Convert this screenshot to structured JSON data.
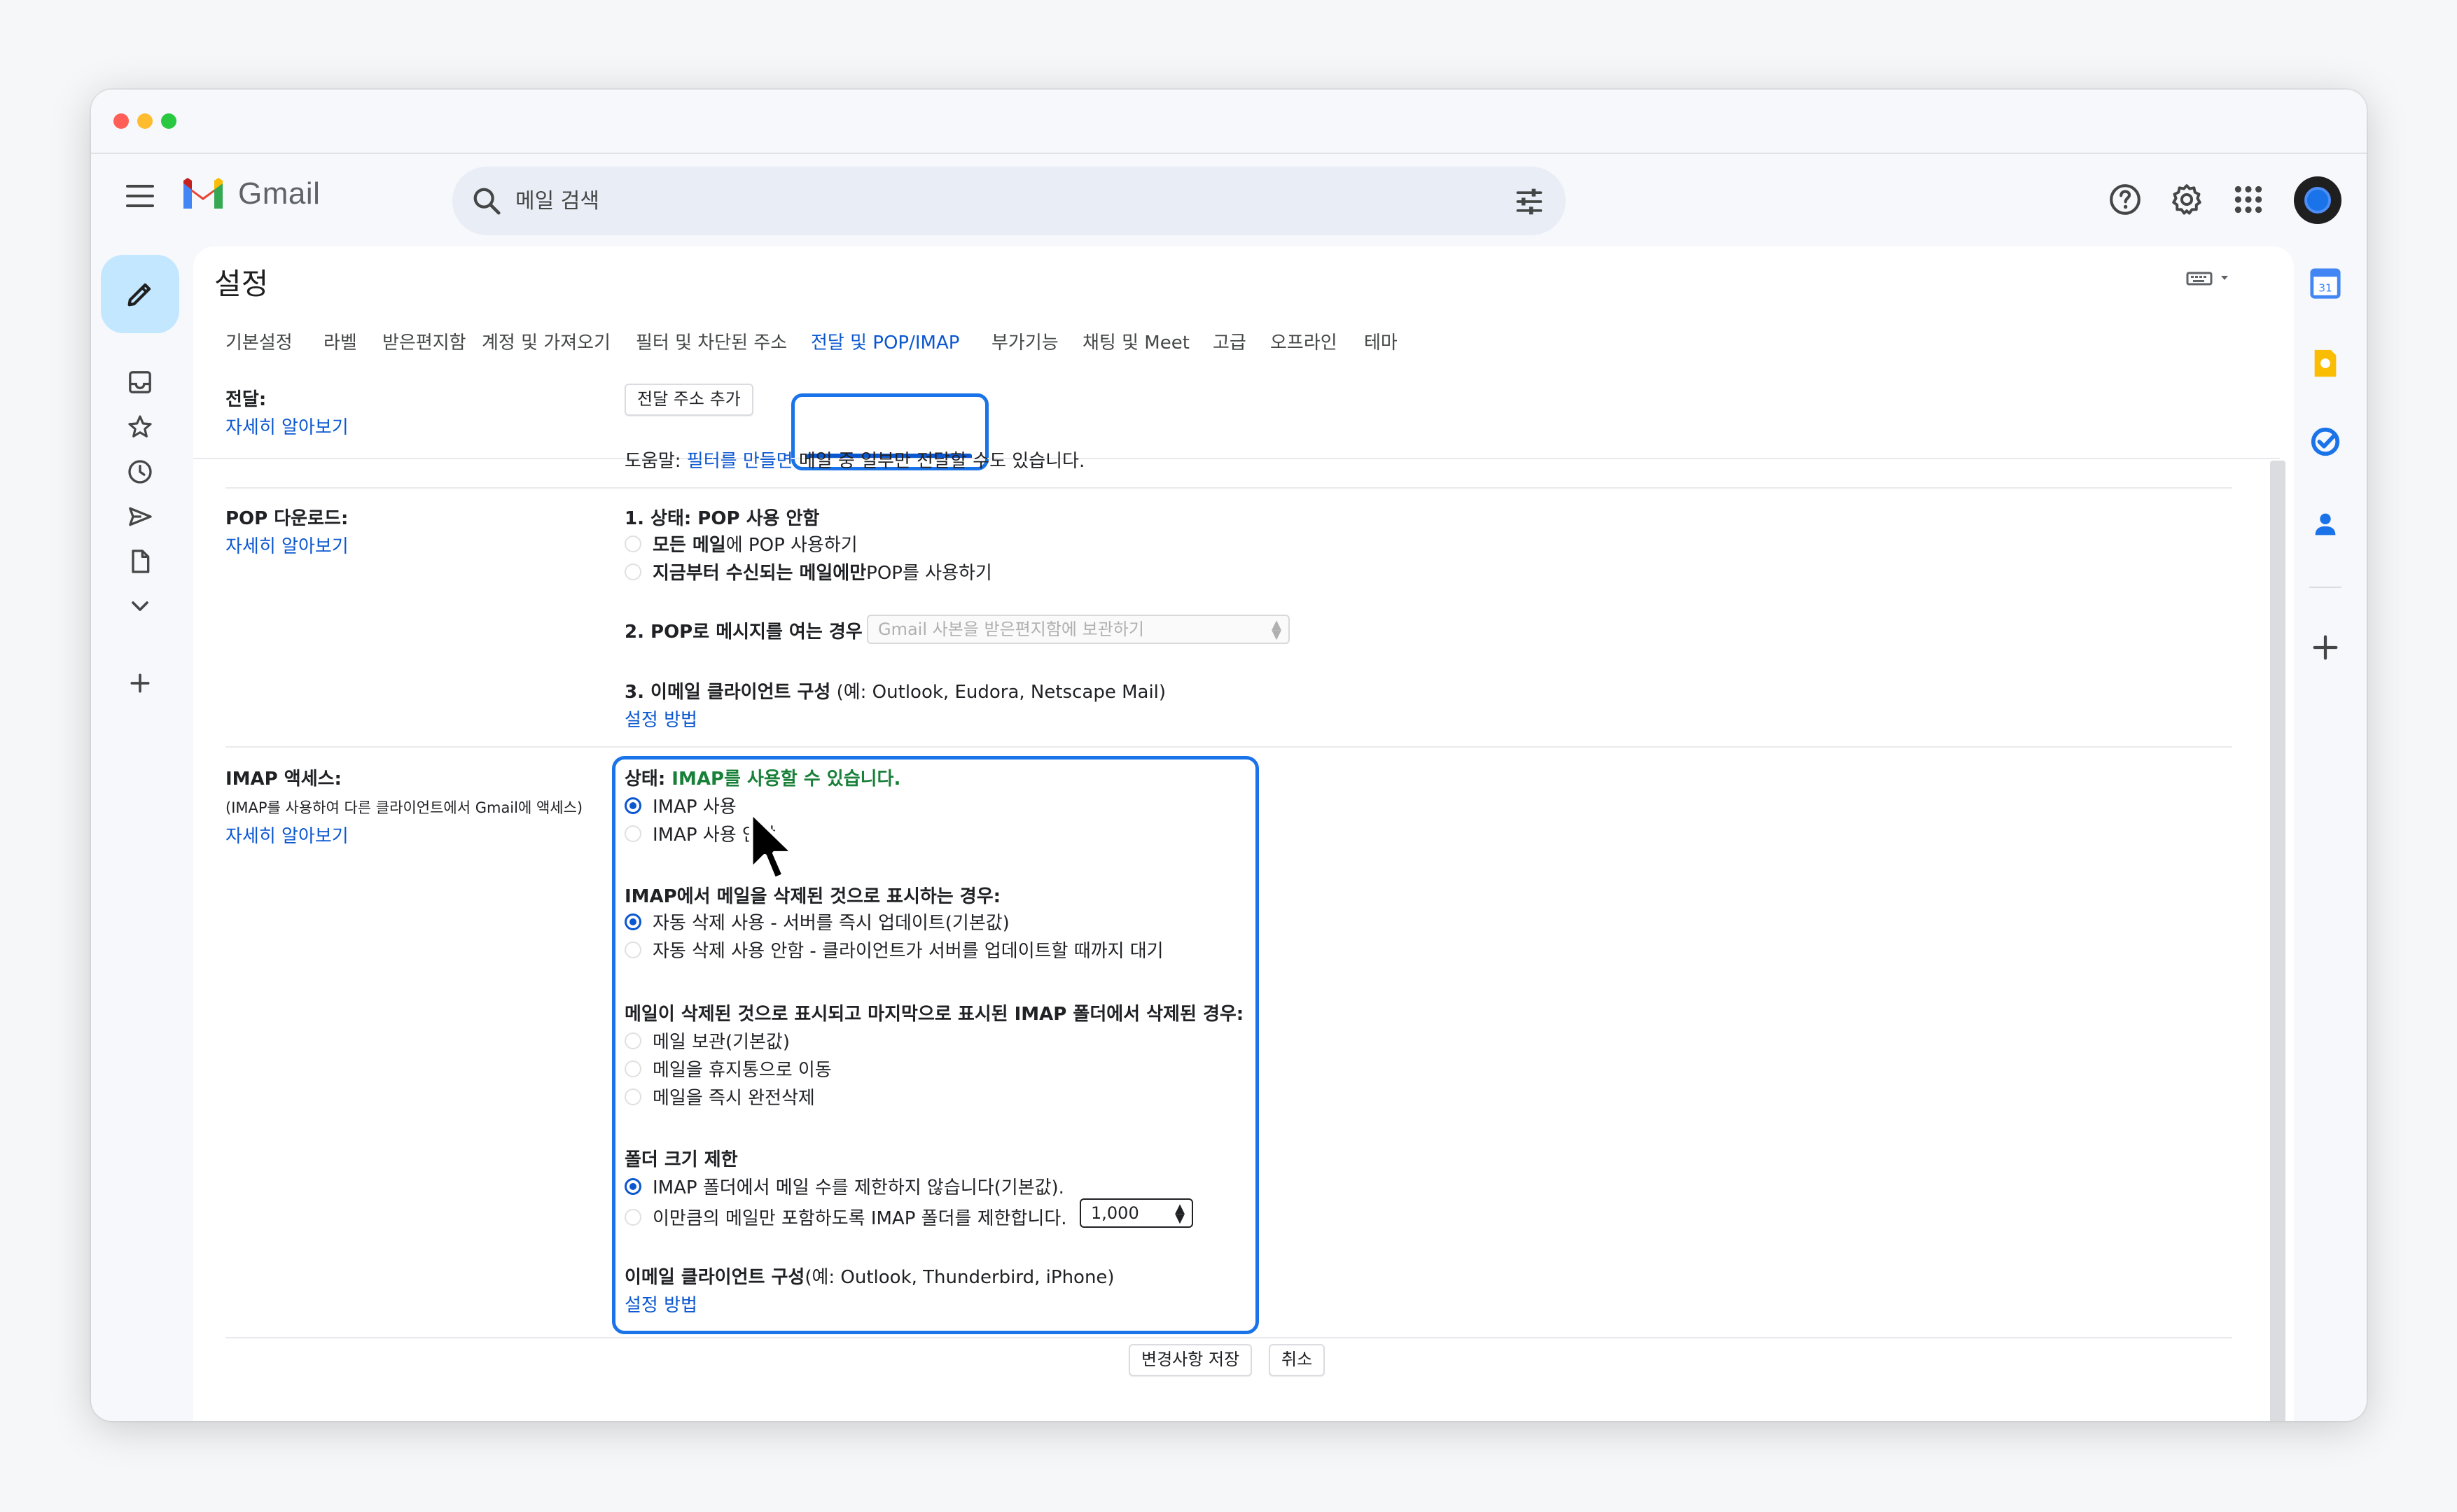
{
  "app": {
    "name": "Gmail"
  },
  "search": {
    "placeholder": "메일 검색"
  },
  "settings": {
    "title": "설정",
    "tabs": [
      {
        "label": "기본설정"
      },
      {
        "label": "라벨"
      },
      {
        "label": "받은편지함"
      },
      {
        "label": "계정 및 가져오기"
      },
      {
        "label": "필터 및 차단된 주소"
      },
      {
        "label": "전달 및 POP/IMAP",
        "active": true
      },
      {
        "label": "부가기능"
      },
      {
        "label": "채팅 및 Meet"
      },
      {
        "label": "고급"
      },
      {
        "label": "오프라인"
      },
      {
        "label": "테마"
      }
    ]
  },
  "forwarding": {
    "heading": "전달:",
    "learn_more": "자세히 알아보기",
    "add_button": "전달 주소 추가",
    "help_prefix": "도움말: ",
    "help_link": "필터를 만들면",
    "help_suffix": " 메일 중 일부만 전달할 수도 있습니다."
  },
  "pop": {
    "heading": "POP 다운로드:",
    "learn_more": "자세히 알아보기",
    "status": "1. 상태: POP 사용 안함",
    "option_all_bold": "모든 메일",
    "option_all_rest": "에 POP 사용하기",
    "option_now_bold": "지금부터 수신되는 메일에만",
    "option_now_rest": " POP를 사용하기",
    "when_accessed": "2. POP로 메시지를 여는 경우",
    "when_select": "Gmail 사본을 받은편지함에 보관하기",
    "client_bold": "3. 이메일 클라이언트 구성",
    "client_rest": " (예: Outlook, Eudora, Netscape Mail)",
    "setup_link": "설정 방법"
  },
  "imap": {
    "heading": "IMAP 액세스:",
    "subheading": "(IMAP를 사용하여 다른 클라이언트에서 Gmail에 액세스)",
    "learn_more": "자세히 알아보기",
    "status_label": "상태: ",
    "status_value": "IMAP를 사용할 수 있습니다.",
    "enable": "IMAP 사용",
    "disable": "IMAP 사용 안함",
    "delete_heading": "IMAP에서 메일을 삭제된 것으로 표시하는 경우:",
    "auto_expunge_on": "자동 삭제 사용 - 서버를 즉시 업데이트(기본값)",
    "auto_expunge_off": "자동 삭제 사용 안함 - 클라이언트가 서버를 업데이트할 때까지 대기",
    "expunge_heading": "메일이 삭제된 것으로 표시되고 마지막으로 표시된 IMAP 폴더에서 삭제된 경우:",
    "archive": "메일 보관(기본값)",
    "trash": "메일을 휴지통으로 이동",
    "delete_forever": "메일을 즉시 완전삭제",
    "folder_heading": "폴더 크기 제한",
    "no_limit": "IMAP 폴더에서 메일 수를 제한하지 않습니다(기본값).",
    "limit": "이만큼의 메일만 포함하도록 IMAP 폴더를 제한합니다.",
    "limit_value": "1,000",
    "client_bold": "이메일 클라이언트 구성",
    "client_rest": "(예: Outlook, Thunderbird, iPhone)",
    "setup_link": "설정 방법"
  },
  "footer": {
    "save": "변경사항 저장",
    "cancel": "취소"
  },
  "colors": {
    "accent": "#0b57d0",
    "highlight": "#1a73e8",
    "status_green": "#188038",
    "compose_bg": "#c2e7ff"
  },
  "icons": {
    "header": [
      "menu-icon",
      "search-icon",
      "tune-icon",
      "help-icon",
      "settings-icon",
      "apps-icon"
    ],
    "rail": [
      "inbox-icon",
      "star-icon",
      "clock-icon",
      "send-icon",
      "draft-icon",
      "expand-icon",
      "plus-icon"
    ],
    "right_rail": [
      "calendar-icon",
      "keep-icon",
      "tasks-icon",
      "contacts-icon",
      "plus-icon"
    ]
  }
}
